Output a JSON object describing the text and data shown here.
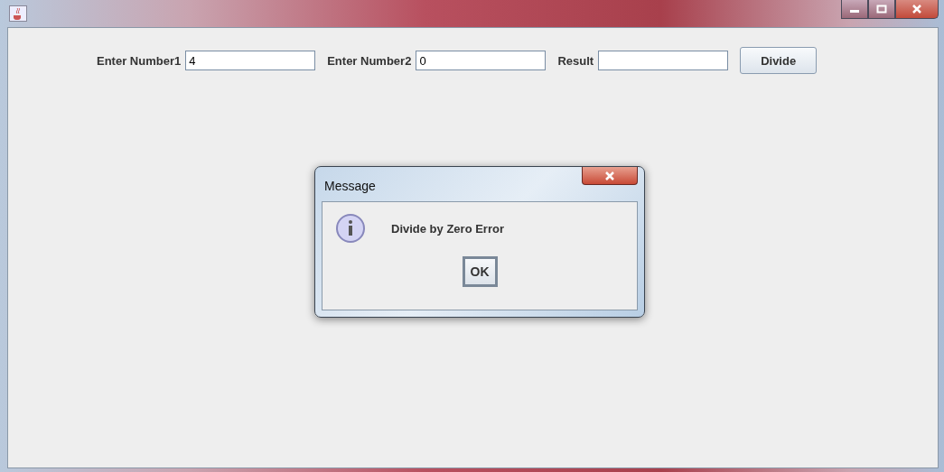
{
  "form": {
    "fields": [
      {
        "label": "Enter Number1",
        "value": "4"
      },
      {
        "label": "Enter Number2",
        "value": "0"
      },
      {
        "label": "Result"
      }
    ],
    "button": "Divide"
  },
  "dialog": {
    "title": "Message",
    "message": "Divide by Zero Error",
    "button": "OK",
    "focused": true
  }
}
